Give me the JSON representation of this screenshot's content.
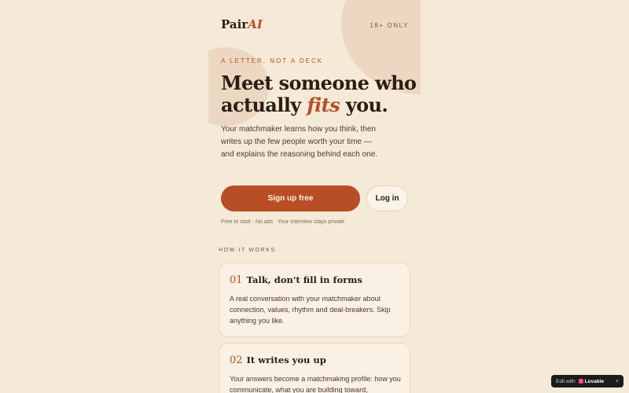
{
  "header": {
    "brand_prefix": "Pair",
    "brand_accent": "AI",
    "age_notice": "18+ ONLY"
  },
  "hero": {
    "eyebrow": "A LETTER, NOT A DECK",
    "headline_line1": "Meet someone who",
    "headline_pre": "actually ",
    "headline_accent": "fits",
    "headline_post": " you.",
    "lede": "Your matchmaker learns how you think, then writes up the few people worth your time — and explains the reasoning behind each one.",
    "primary_cta": "Sign up free",
    "secondary_cta": "Log in",
    "fineprint": "Free to start · No ads · Your interview stays private"
  },
  "how_it_works": {
    "label": "HOW IT WORKS",
    "steps": [
      {
        "number": "01",
        "title": "Talk, don't fill in forms",
        "body": "A real conversation with your matchmaker about connection, values, rhythm and deal-breakers. Skip anything you like."
      },
      {
        "number": "02",
        "title": "It writes you up",
        "body": "Your answers become a matchmaking profile: how you communicate, what you are building toward,"
      }
    ]
  },
  "badge": {
    "edit_with": "Edit with",
    "brand": "Lovable",
    "close": "×"
  },
  "colors": {
    "background": "#f5ead8",
    "accent": "#b84e25",
    "ink": "#2b1d14",
    "card": "#faf0e3"
  }
}
